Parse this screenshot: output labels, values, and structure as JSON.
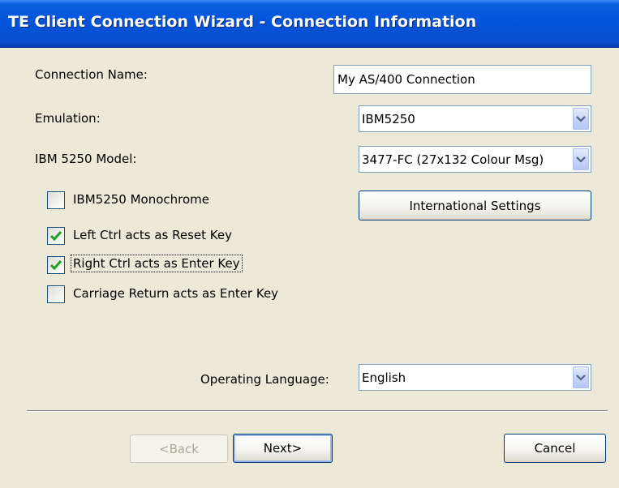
{
  "window": {
    "title": "TE Client Connection Wizard - Connection Information"
  },
  "fields": {
    "connection_name": {
      "label": "Connection Name:",
      "value": "My AS/400 Connection"
    },
    "emulation": {
      "label": "Emulation:",
      "value": "IBM5250"
    },
    "model": {
      "label": "IBM 5250 Model:",
      "value": "3477-FC (27x132 Colour Msg)"
    },
    "operating_language": {
      "label": "Operating Language:",
      "value": "English"
    }
  },
  "checkboxes": [
    {
      "label": "IBM5250 Monochrome",
      "checked": false
    },
    {
      "label": "Left Ctrl acts as Reset Key",
      "checked": true
    },
    {
      "label": "Right Ctrl acts as Enter Key",
      "checked": true
    },
    {
      "label": "Carriage Return acts as Enter Key",
      "checked": false
    }
  ],
  "buttons": {
    "international_settings": "International Settings",
    "back": "<Back",
    "next": "Next>",
    "cancel": "Cancel"
  },
  "colors": {
    "title_bar": "#0453D9",
    "window_bg": "#ECE9D8",
    "check_mark": "#21A121"
  }
}
